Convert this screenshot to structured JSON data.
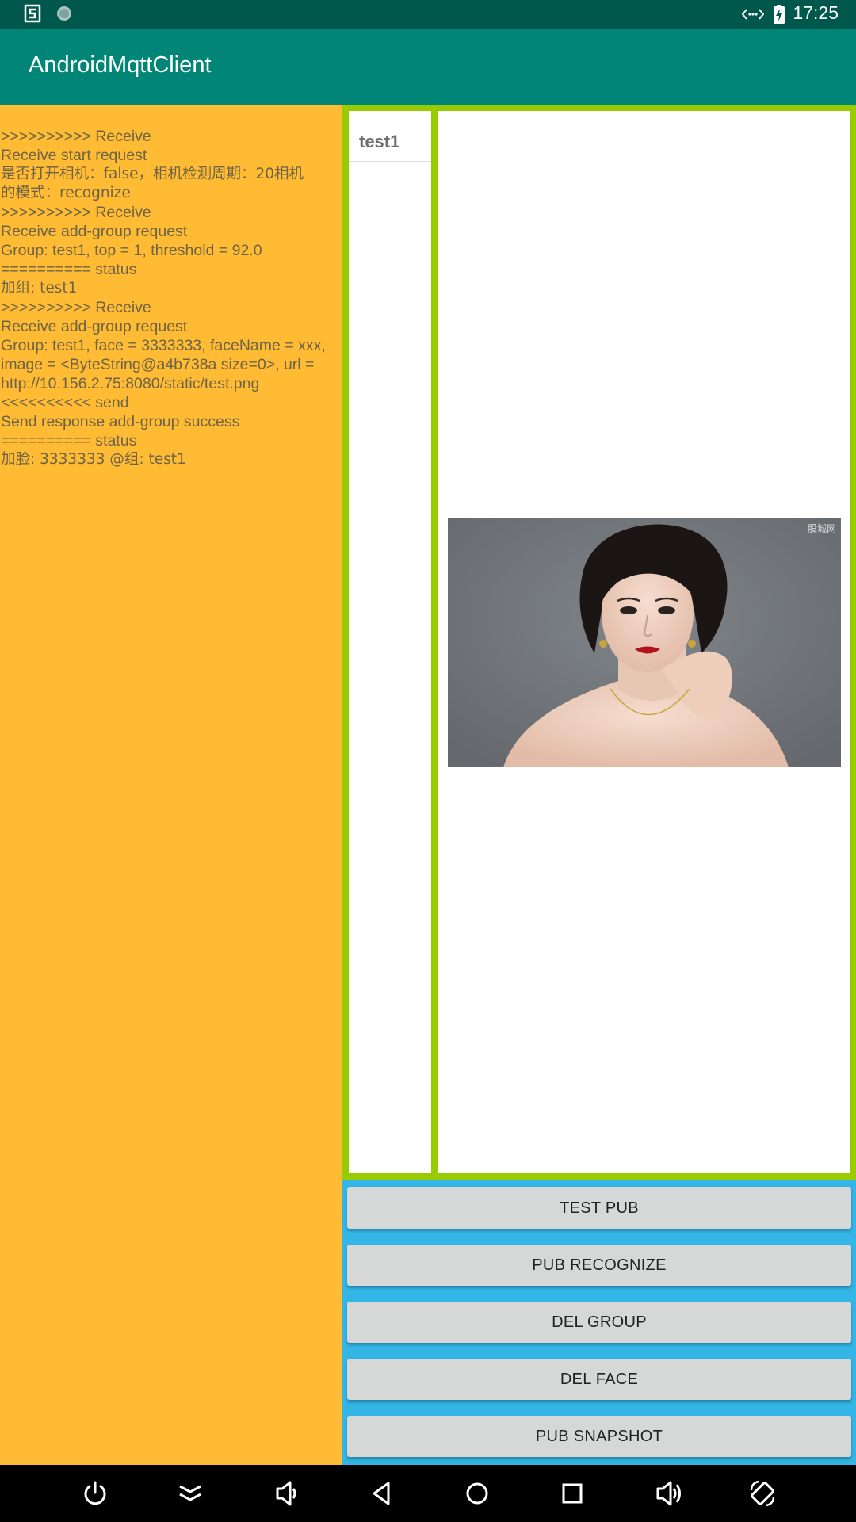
{
  "status_bar": {
    "time": "17:25",
    "left_icons": [
      "app-s-icon",
      "circle-dot-icon"
    ],
    "right_icons": [
      "data-transfer-icon",
      "battery-charging-icon"
    ]
  },
  "app_bar": {
    "title": "AndroidMqttClient"
  },
  "log": {
    "lines": [
      ">>>>>>>>>> Receive",
      "Receive start request",
      "是否打开相机：false，相机检测周期：20相机",
      "的模式：recognize",
      ">>>>>>>>>> Receive",
      "Receive add-group request",
      "Group: test1, top = 1, threshold = 92.0",
      "========== status",
      "加组: test1",
      ">>>>>>>>>> Receive",
      "Receive add-group request",
      "Group: test1, face = 3333333, faceName = xxx,",
      "image = <ByteString@a4b738a size=0>, url =",
      "http://10.156.2.75:8080/static/test.png",
      "<<<<<<<<<< send",
      "Send response add-group success",
      "========== status",
      "加脸: 3333333 @组: test1"
    ]
  },
  "groups": {
    "items": [
      "test1"
    ]
  },
  "face_view": {
    "watermark": "股城网"
  },
  "buttons": {
    "test_pub": "TEST PUB",
    "pub_recognize": "PUB RECOGNIZE",
    "del_group": "DEL GROUP",
    "del_face": "DEL FACE",
    "pub_snapshot": "PUB SNAPSHOT"
  },
  "nav_bar": {
    "icons": [
      "power-icon",
      "collapse-icon",
      "volume-down-icon",
      "back-icon",
      "home-icon",
      "recents-icon",
      "volume-up-icon",
      "rotate-icon"
    ]
  },
  "colors": {
    "status_bar": "#00574b",
    "app_bar": "#008577",
    "log_background": "#ffbb33",
    "list_border": "#99cc00",
    "button_panel": "#33b5e5",
    "button": "#d6d7d7"
  }
}
